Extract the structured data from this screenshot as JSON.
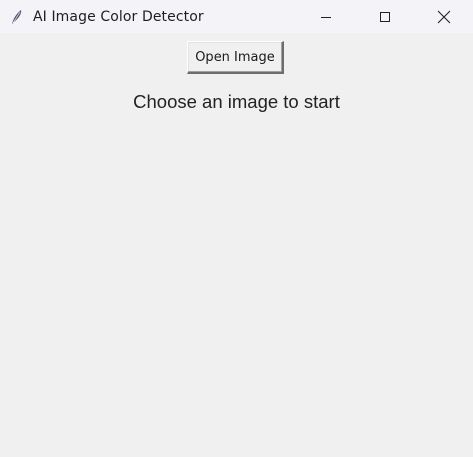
{
  "window": {
    "title": "AI Image Color Detector",
    "icon": "feather-icon",
    "controls": {
      "minimize_icon": "minimize-icon",
      "maximize_icon": "maximize-icon",
      "close_icon": "close-icon"
    }
  },
  "main": {
    "open_button_label": "Open Image",
    "status_text": "Choose an image to start"
  },
  "colors": {
    "background": "#f0f0f0",
    "titlebar": "#f3f3f8",
    "text": "#222222"
  }
}
